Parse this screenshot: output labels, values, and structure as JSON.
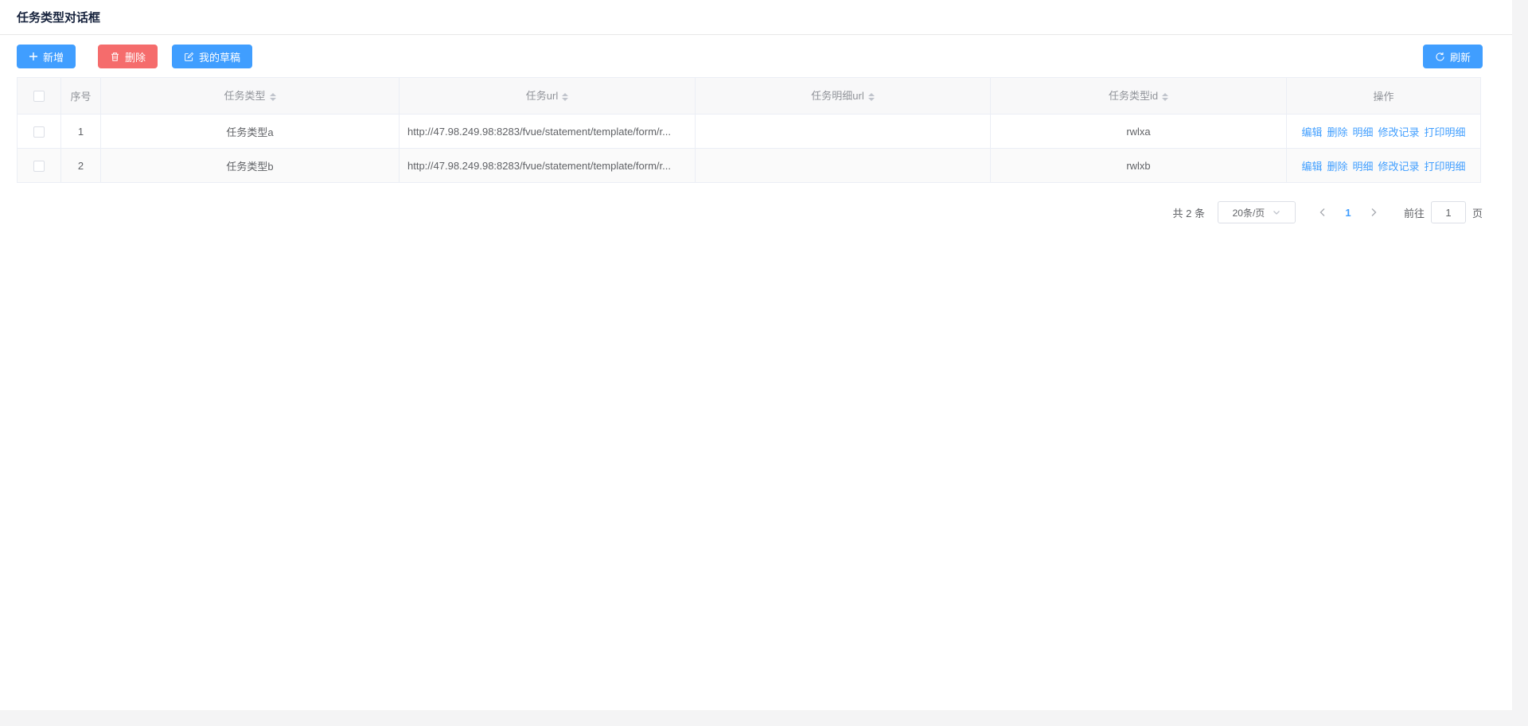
{
  "page": {
    "title": "任务类型对话框"
  },
  "colors": {
    "primary": "#409eff",
    "danger": "#f56c6c",
    "link": "#409eff",
    "page_bg": "#f4f4f5"
  },
  "toolbar": {
    "add_label": "新增",
    "delete_label": "删除",
    "drafts_label": "我的草稿",
    "refresh_label": "刷新",
    "icons": {
      "add": "plus-icon",
      "delete": "trash-icon",
      "drafts": "edit-icon",
      "refresh": "refresh-icon"
    }
  },
  "table": {
    "columns": {
      "index": "序号",
      "task_type": "任务类型",
      "task_url": "任务url",
      "task_detail_url": "任务明细url",
      "task_type_id": "任务类型id",
      "operation": "操作"
    },
    "sortable_columns": [
      "任务类型",
      "任务url",
      "任务明细url",
      "任务类型id"
    ],
    "rows": [
      {
        "index": "1",
        "task_type": "任务类型a",
        "task_url": "http://47.98.249.98:8283/fvue/statement/template/form/r...",
        "task_detail_url": "",
        "task_type_id": "rwlxa"
      },
      {
        "index": "2",
        "task_type": "任务类型b",
        "task_url": "http://47.98.249.98:8283/fvue/statement/template/form/r...",
        "task_detail_url": "",
        "task_type_id": "rwlxb"
      }
    ],
    "operations": [
      "编辑",
      "删除",
      "明细",
      "修改记录",
      "打印明细"
    ]
  },
  "pagination": {
    "total_text": "共 2 条",
    "page_size": "20条/页",
    "current_page": "1",
    "goto_label": "前往",
    "goto_value": "1",
    "page_unit": "页",
    "icons": {
      "dropdown": "chevron-down-icon",
      "prev": "chevron-left-icon",
      "next": "chevron-right-icon"
    }
  }
}
